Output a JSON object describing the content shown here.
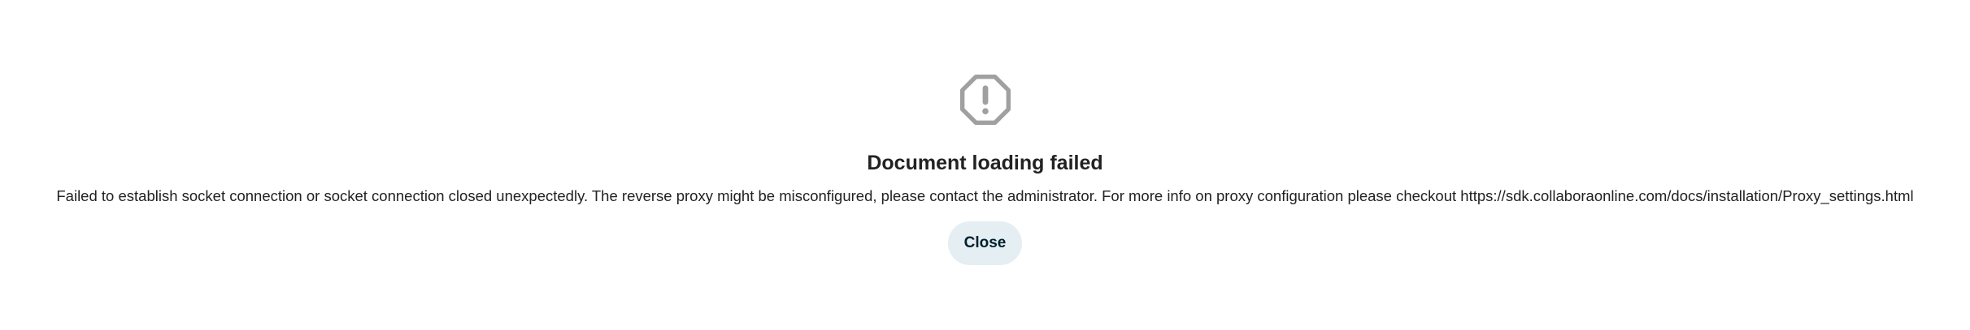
{
  "dialog": {
    "icon": "alert-octagon-icon",
    "icon_color": "#a0a0a0",
    "title": "Document loading failed",
    "message": "Failed to establish socket connection or socket connection closed unexpectedly. The reverse proxy might be misconfigured, please contact the administrator. For more info on proxy configuration please checkout https://sdk.collaboraonline.com/docs/installation/Proxy_settings.html",
    "close_label": "Close"
  },
  "colors": {
    "background": "#ffffff",
    "text": "#222222",
    "button_background": "#e4eef3",
    "button_text": "#00202e"
  }
}
